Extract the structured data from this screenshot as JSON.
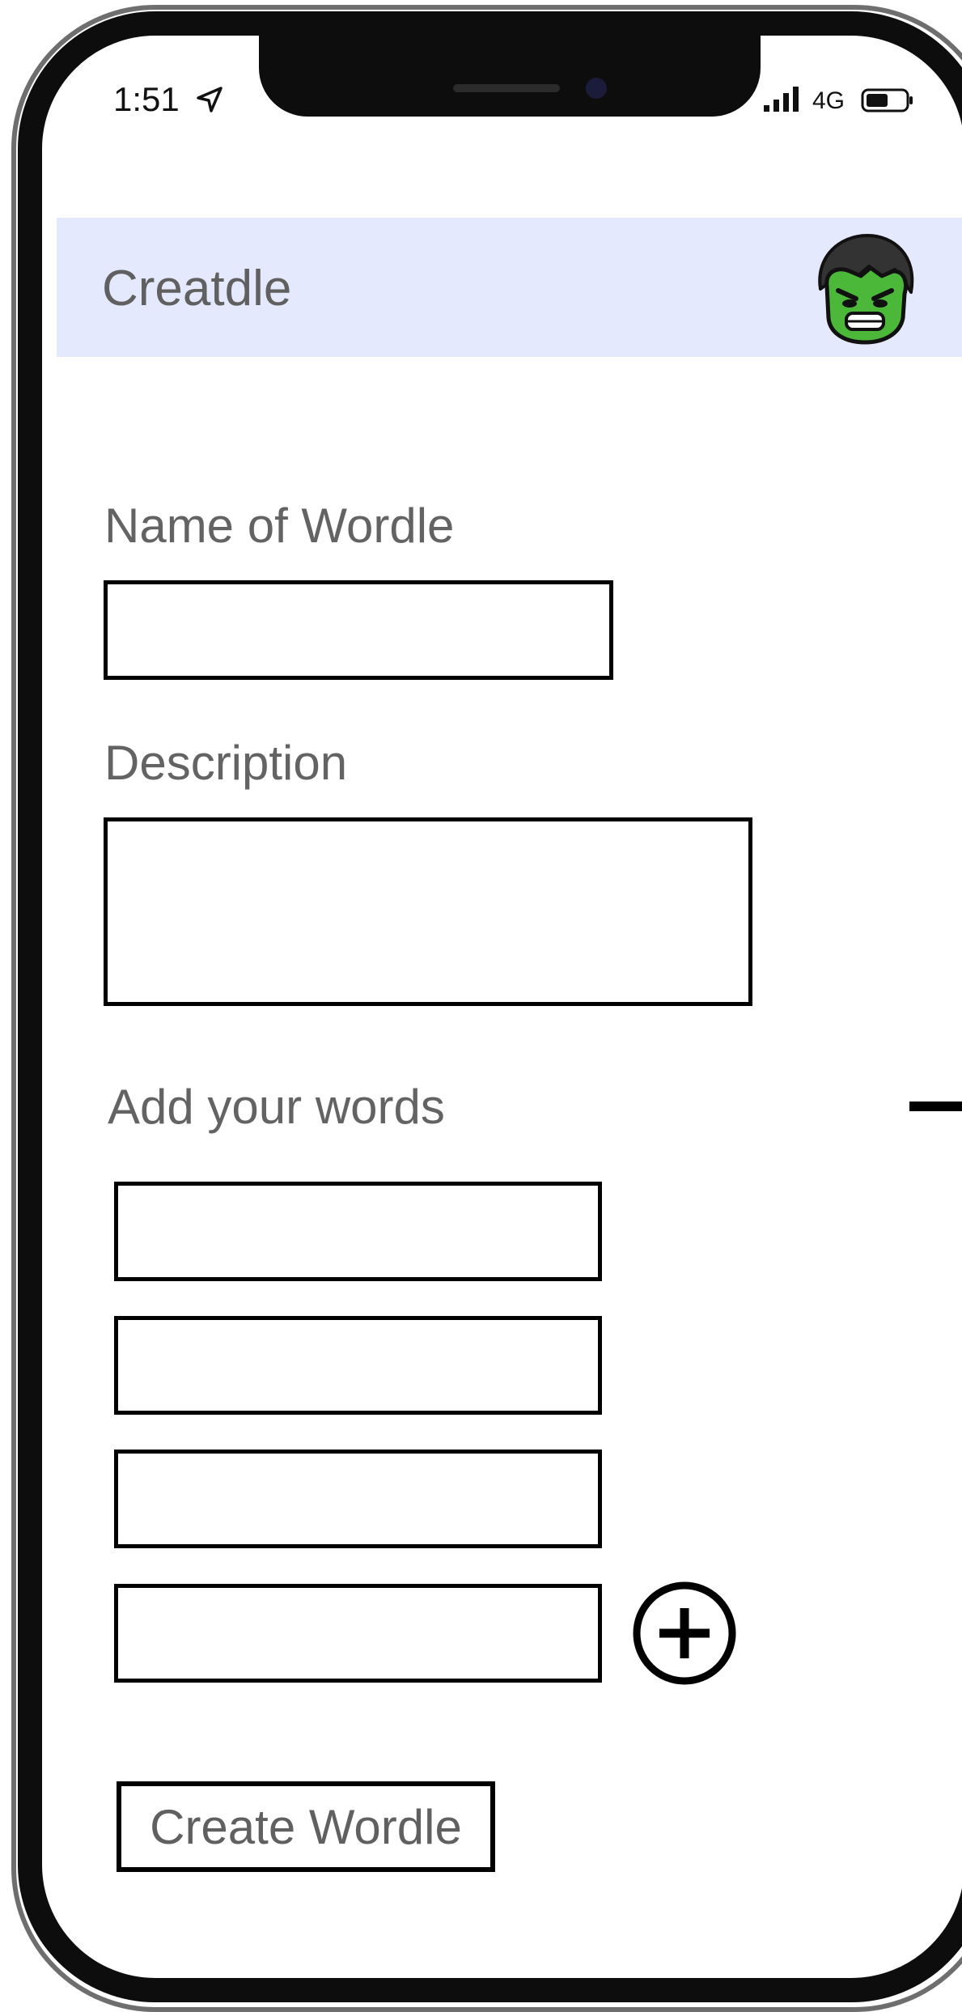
{
  "status_bar": {
    "time": "1:51",
    "network": "4G",
    "icons": [
      "location-arrow-icon",
      "signal-bars-icon",
      "battery-icon"
    ]
  },
  "header": {
    "title": "Creatdle",
    "avatar_icon": "hulk-avatar-icon",
    "background": "#e4e9fd"
  },
  "form": {
    "name_label": "Name of Wordle",
    "name_value": "",
    "description_label": "Description",
    "description_value": "",
    "words_label": "Add your words",
    "words": [
      "",
      "",
      "",
      ""
    ],
    "add_word_icon": "plus-circle-icon",
    "submit_label": "Create Wordle"
  },
  "colors": {
    "text_gray": "#606060",
    "border": "#000000",
    "header_bg": "#e4e9fd",
    "avatar_green": "#4cb83a"
  }
}
